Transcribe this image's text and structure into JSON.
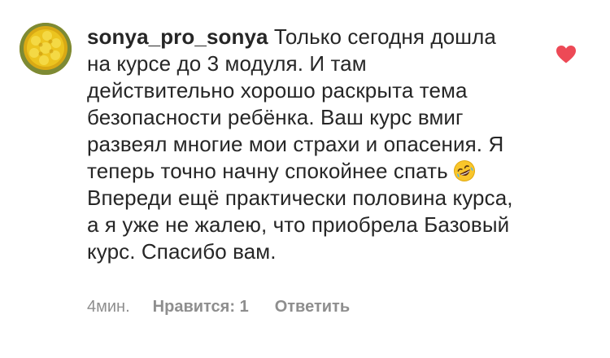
{
  "comment": {
    "username": "sonya_pro_sonya",
    "text_before_emoji": " Только сегодня дошла на курсе до 3 модуля. И там действительно хорошо раскрыта тема безопасности ребёнка. Ваш курс вмиг развеял многие мои страхи и опасения. Я теперь точно начну спокойнее спать",
    "emoji": "rolling-on-floor-laughing-emoji",
    "text_after_emoji": "Впереди ещё практически половина курса, а я уже не жалею, что приобрела Базовый курс. Спасибо вам.",
    "time": "4мин.",
    "likes_label": "Нравится: 1",
    "reply_label": "Ответить",
    "like_icon": "heart-icon",
    "like_color": "#ed4956"
  }
}
